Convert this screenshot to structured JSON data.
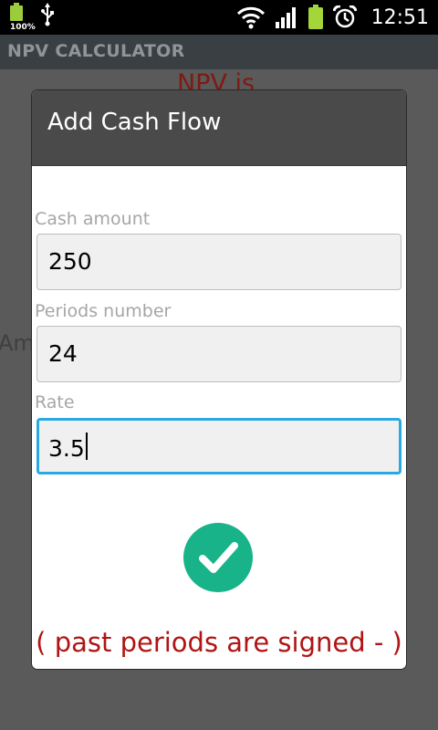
{
  "status_bar": {
    "battery_percent": "100%",
    "time": "12:51",
    "icons": [
      "battery-icon",
      "usb-icon",
      "wifi-icon",
      "signal-icon",
      "battery-icon",
      "alarm-icon"
    ]
  },
  "app": {
    "title": "NPV CALCULATOR"
  },
  "background": {
    "npv_text": "NPV is",
    "amount_text": "Am"
  },
  "dialog": {
    "title": "Add Cash Flow",
    "fields": [
      {
        "label": "Cash amount",
        "value": "250"
      },
      {
        "label": "Periods number",
        "value": "24"
      },
      {
        "label": "Rate",
        "value": "3.5"
      }
    ],
    "confirm_icon": "check-icon",
    "footnote": "( past periods are signed - )"
  },
  "colors": {
    "accent_focus": "#2aa9e0",
    "confirm_green": "#18b389",
    "footnote_red": "#b01414"
  }
}
